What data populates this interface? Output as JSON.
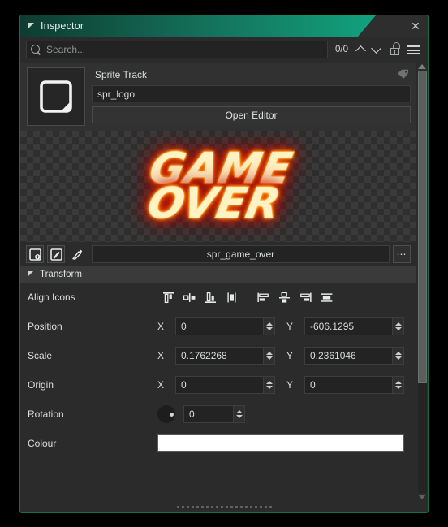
{
  "window": {
    "title": "Inspector",
    "close_label": "✕",
    "collapse_icon": "collapse-triangle-icon"
  },
  "search": {
    "placeholder": "Search...",
    "counter": "0/0",
    "prev_label": "prev-match",
    "next_label": "next-match",
    "lock_icon": "unlocked-padlock-icon",
    "menu_icon": "hamburger-menu-icon"
  },
  "track": {
    "title": "Sprite Track",
    "name_value": "spr_logo",
    "open_editor_label": "Open Editor",
    "tag_icon": "tag-icon",
    "thumbnail_icon": "sprite-thumbnail-icon"
  },
  "preview": {
    "sprite_line_1": "GAME",
    "sprite_line_2": "OVER",
    "background": "checkerboard-transparency"
  },
  "sprite_toolbar": {
    "new_sprite_icon": "add-sprite-icon",
    "edit_sprite_icon": "edit-sprite-icon",
    "brush_icon": "paintbrush-icon",
    "sprite_name": "spr_game_over",
    "more_label": "⋯"
  },
  "transform": {
    "header": "Transform",
    "align": {
      "label": "Align Icons",
      "buttons": [
        "align-top-icon",
        "align-vertical-center-icon",
        "align-bottom-icon",
        "align-middle-icon",
        "align-left-icon",
        "align-horizontal-center-icon",
        "align-right-icon",
        "align-stretch-icon"
      ]
    },
    "rows": [
      {
        "label": "Position",
        "x_axis": "X",
        "x": "0",
        "y_axis": "Y",
        "y": "-606.1295"
      },
      {
        "label": "Scale",
        "x_axis": "X",
        "x": "0.1762268",
        "y_axis": "Y",
        "y": "0.2361046"
      },
      {
        "label": "Origin",
        "x_axis": "X",
        "x": "0",
        "y_axis": "Y",
        "y": "0"
      }
    ],
    "rotation": {
      "label": "Rotation",
      "value": "0",
      "dial_icon": "rotation-dial-icon"
    },
    "colour": {
      "label": "Colour",
      "value": "#FFFFFF"
    }
  },
  "colors": {
    "accent": "#12a37e",
    "panel": "#2b2b2b",
    "field": "#232323",
    "swatch": "#ffffff"
  }
}
